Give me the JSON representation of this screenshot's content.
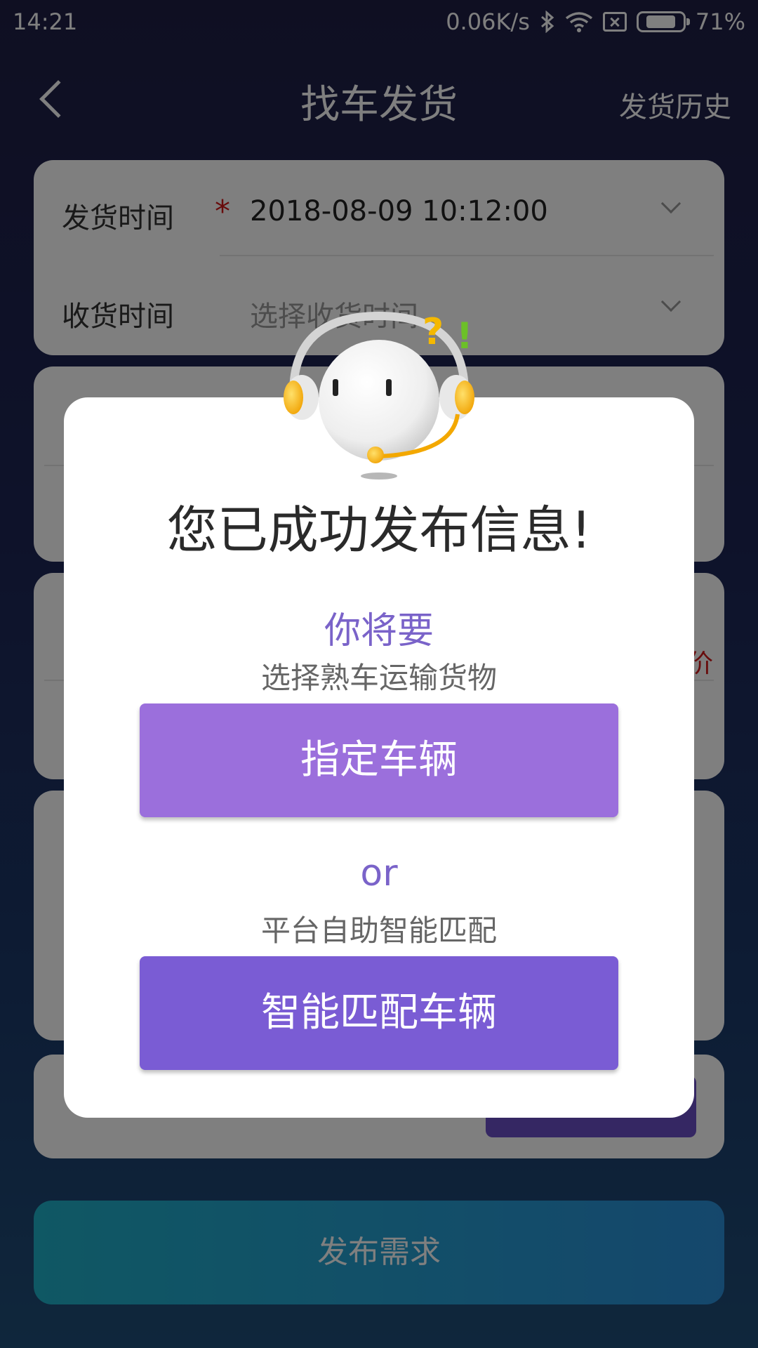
{
  "status_bar": {
    "time": "14:21",
    "network_speed": "0.06K/s",
    "battery_percent": "71%",
    "icons": [
      "bluetooth-icon",
      "wifi-icon",
      "no-sim-icon",
      "battery-icon"
    ]
  },
  "header": {
    "title": "找车发货",
    "history": "发货历史"
  },
  "form": {
    "ship_time_label": "发货时间",
    "ship_time_required": "*",
    "ship_time_value": "2018-08-09 10:12:00",
    "receive_time_label": "收货时间",
    "receive_time_placeholder": "选择收货时间",
    "price_hint": "价"
  },
  "publish_button": "发布需求",
  "modal": {
    "headline": "您已成功发布信息!",
    "you_will": "你将要",
    "option1_desc": "选择熟车运输货物",
    "option1_button": "指定车辆",
    "or": "or",
    "option2_desc": "平台自助智能匹配",
    "option2_button": "智能匹配车辆"
  },
  "colors": {
    "accent_purple": "#7a63c9",
    "button_light_purple": "#9b6fdc",
    "button_purple": "#7a5cd4",
    "required_red": "#d01818"
  }
}
